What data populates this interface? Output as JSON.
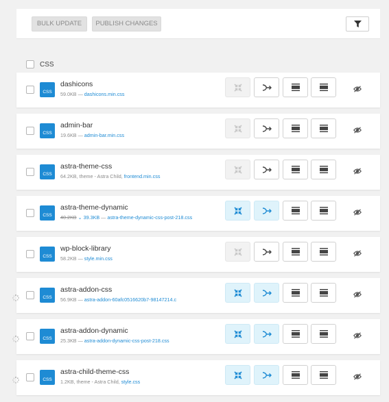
{
  "toolbar": {
    "bulk_update": "BULK UPDATE",
    "publish_changes": "PUBLISH CHANGES",
    "filter_icon": "filter-icon"
  },
  "section": {
    "label": "CSS"
  },
  "colors": {
    "accent": "#1e8bd4",
    "active_bg": "#dff3fb",
    "disabled_bg": "#f2f2f2"
  },
  "rows": [
    {
      "name": "dashicons",
      "size": "59.0KB",
      "sep": " — ",
      "file": "dashicons.min.css",
      "active": false,
      "spinner": false
    },
    {
      "name": "admin-bar",
      "size": "19.6KB",
      "sep": " — ",
      "file": "admin-bar.min.css",
      "active": false,
      "spinner": false
    },
    {
      "name": "astra-theme-css",
      "size": "64.2KB, theme - Astra Child, ",
      "sep": "",
      "file": "frontend.min.css",
      "active": false,
      "spinner": false
    },
    {
      "name": "astra-theme-dynamic",
      "size_old": "40.2KB",
      "size_new": "39.3KB",
      "sep": " — ",
      "file": "astra-theme-dynamic-css-post-218.css",
      "active": true,
      "spinner": false
    },
    {
      "name": "wp-block-library",
      "size": "58.2KB",
      "sep": " — ",
      "file": "style.min.css",
      "active": false,
      "spinner": false
    },
    {
      "name": "astra-addon-css",
      "size": "56.9KB",
      "sep": " — ",
      "file": "astra-addon-60afc0516620b7-98147214.c",
      "active": true,
      "spinner": true
    },
    {
      "name": "astra-addon-dynamic",
      "size": "25.3KB",
      "sep": " — ",
      "file": "astra-addon-dynamic-css-post-218.css",
      "active": true,
      "spinner": true
    },
    {
      "name": "astra-child-theme-css",
      "size": "1.2KB, theme - Astra Child, ",
      "sep": "",
      "file": "style.css",
      "active": true,
      "spinner": true
    }
  ]
}
